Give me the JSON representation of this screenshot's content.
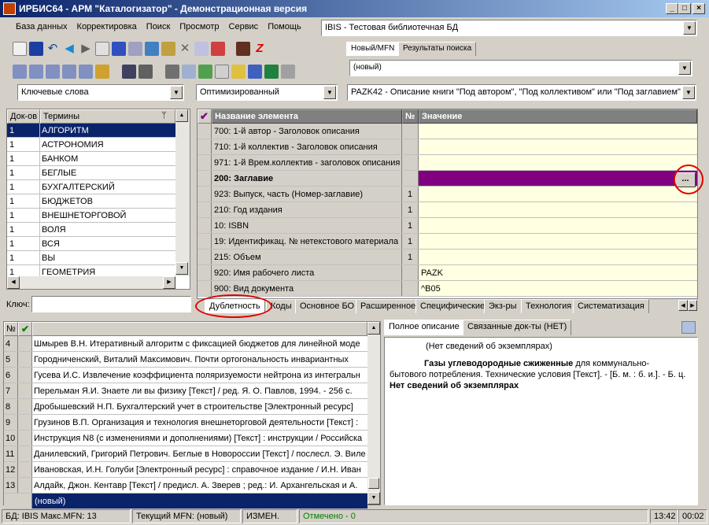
{
  "window": {
    "title": "ИРБИС64 - АРМ \"Каталогизатор\" - Демонстрационная версия",
    "minimize": "_",
    "maximize": "□",
    "close": "×"
  },
  "menu": [
    "База данных",
    "Корректировка",
    "Поиск",
    "Просмотр",
    "Сервис",
    "Помощь"
  ],
  "db_combo": {
    "value": "IBIS - Тестовая библиотечная БД"
  },
  "top_tabs": [
    "Новый/MFN",
    "Результаты поиска"
  ],
  "mfn_combo": {
    "value": "(новый)"
  },
  "search_combo": {
    "value": "Ключевые слова"
  },
  "mode_combo": {
    "value": "Оптимизированный"
  },
  "worksheet_combo": {
    "value": "PAZK42 - Описание книги \"Под автором\", \"Под коллективом\" или \"Под заглавием\""
  },
  "dict": {
    "col_count": "Док-ов",
    "col_terms": "Термины",
    "rows": [
      {
        "n": "1",
        "t": "АЛГОРИТМ"
      },
      {
        "n": "1",
        "t": "АСТРОНОМИЯ"
      },
      {
        "n": "1",
        "t": "БАНКОМ"
      },
      {
        "n": "1",
        "t": "БЕГЛЫЕ"
      },
      {
        "n": "1",
        "t": "БУХГАЛТЕРСКИЙ"
      },
      {
        "n": "1",
        "t": "БЮДЖЕТОВ"
      },
      {
        "n": "1",
        "t": "ВНЕШНЕТОРГОВОЙ"
      },
      {
        "n": "1",
        "t": "ВОЛЯ"
      },
      {
        "n": "1",
        "t": "ВСЯ"
      },
      {
        "n": "1",
        "t": "ВЫ"
      },
      {
        "n": "1",
        "t": "ГЕОМЕТРИЯ"
      }
    ],
    "key_label": "Ключ:"
  },
  "editor": {
    "col_check": "✔",
    "col_name": "Название элемента",
    "col_num": "№",
    "col_value": "Значение",
    "rows": [
      {
        "name": "700: 1-й автор - Заголовок описания",
        "num": "",
        "value": "",
        "bold": false,
        "selected": false
      },
      {
        "name": "710: 1-й коллектив - Заголовок описания",
        "num": "",
        "value": "",
        "bold": false,
        "selected": false
      },
      {
        "name": "971: 1-й Врем.коллектив - заголовок описания",
        "num": "",
        "value": "",
        "bold": false,
        "selected": false
      },
      {
        "name": "200: Заглавие",
        "num": "",
        "value": "",
        "bold": true,
        "selected": true
      },
      {
        "name": "923: Выпуск, часть (Номер-заглавие)",
        "num": "1",
        "value": "",
        "bold": false,
        "selected": false
      },
      {
        "name": "210: Год издания",
        "num": "1",
        "value": "",
        "bold": false,
        "selected": false
      },
      {
        "name": "10: ISBN",
        "num": "1",
        "value": "",
        "bold": false,
        "selected": false
      },
      {
        "name": "19: Идентификац. № нетекстового материала",
        "num": "1",
        "value": "",
        "bold": false,
        "selected": false
      },
      {
        "name": "215: Объем",
        "num": "1",
        "value": "",
        "bold": false,
        "selected": false
      },
      {
        "name": "920: Имя рабочего листа",
        "num": "",
        "value": "PAZK",
        "bold": false,
        "selected": false
      },
      {
        "name": "900: Вид документа",
        "num": "",
        "value": "^B05",
        "bold": false,
        "selected": false
      }
    ],
    "ellipsis": "...",
    "tabs": [
      "Дублетность",
      "Коды",
      "Основное БО",
      "Расширенное",
      "Специфические",
      "Экз-ры",
      "Технология",
      "Систематизация"
    ]
  },
  "results": {
    "col_num": "№",
    "col_check": "✔",
    "rows": [
      {
        "n": "4",
        "t": "Шмырев В.Н. Итеративный алгоритм с фиксацией бюджетов для линейной моде"
      },
      {
        "n": "5",
        "t": "Городниченский, Виталий Максимович. Почти ортогональность инвариантных"
      },
      {
        "n": "6",
        "t": "Гусева И.С. Извлечение коэффициента поляризуемости нейтрона из интегральн"
      },
      {
        "n": "7",
        "t": "Перельман Я.И. Знаете ли вы физику [Текст] / ред. Я. О. Павлов, 1994. - 256 с."
      },
      {
        "n": "8",
        "t": "Дробышевский Н.П. Бухгалтерский учет в строительстве [Электронный ресурс]"
      },
      {
        "n": "9",
        "t": "Грузинов В.П. Организация и технология внешнеторговой деятельности [Текст] :"
      },
      {
        "n": "10",
        "t": "Инструкция N8   (с изменениями и дополнениями) [Текст] : инструкции / Российска"
      },
      {
        "n": "11",
        "t": "Данилевский, Григорий Петрович. Беглые в Новороссии [Текст] / послесл. Э. Виле"
      },
      {
        "n": "12",
        "t": "Ивановская, И.Н. Голуби [Электронный ресурс] : справочное издание / И.Н. Иван"
      },
      {
        "n": "13",
        "t": "Алдайк, Джон. Кентавр [Текст] / предисл. А. Зверев ; ред.: И. Архангельская и А."
      }
    ],
    "new_row": "(новый)"
  },
  "desc": {
    "tabs": [
      "Полное описание",
      "Связанные док-ты (НЕТ)"
    ],
    "line1": "(Нет сведений об экземплярах)",
    "title_bold": "Газы углеводородные сжиженные",
    "line2_rest": " для коммунально-",
    "line3": "бытового потребления. Технические условия [Текст]. - [Б. м. : б. и.]. - Б. ц.",
    "line4": "Нет сведений об экземплярах"
  },
  "status": {
    "db": "БД: IBIS Макс.MFN: 13",
    "mfn": "Текущий MFN: (новый)",
    "changed": "ИЗМЕН.",
    "marked": "Отмечено - 0",
    "time": "13:42",
    "clock": "00:02"
  },
  "colors": {
    "title_start": "#0a246a",
    "selection": "#0a246a",
    "purple": "#800080",
    "value_bg": "#ffffe1",
    "marked": "#008000",
    "annotation": "#e00000"
  }
}
